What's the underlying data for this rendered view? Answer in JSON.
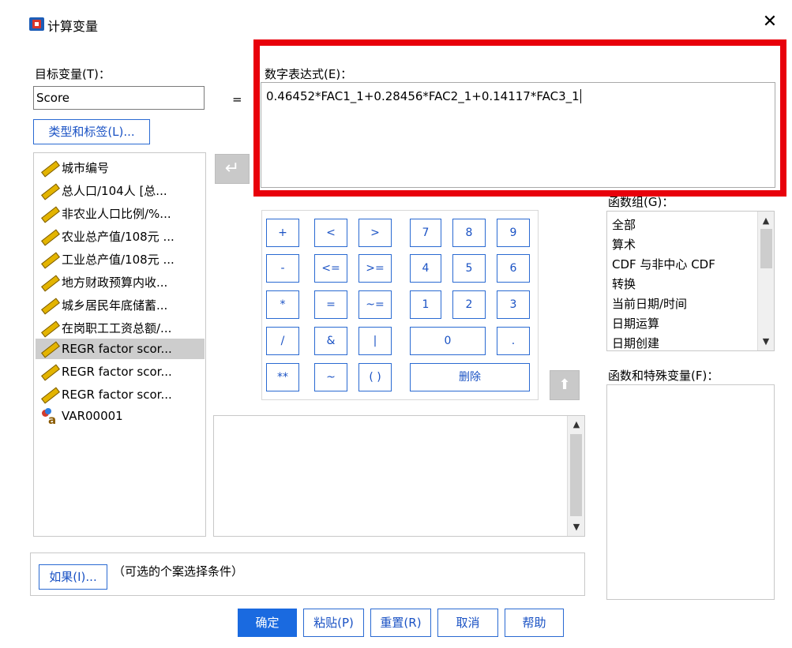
{
  "window": {
    "title": "计算变量",
    "close_glyph": "✕"
  },
  "target_variable": {
    "label": "目标变量(T)：",
    "value": "Score",
    "type_label_button": "类型和标签(L)..."
  },
  "equals_sign": "=",
  "numeric_expression": {
    "label": "数字表达式(E)：",
    "value": "0.46452*FAC1_1+0.28456*FAC2_1+0.14117*FAC3_1"
  },
  "variables": [
    {
      "label": "城市编号",
      "icon": "scale-ruler-icon",
      "selected": false
    },
    {
      "label": "总人口/104人 [总...",
      "icon": "scale-ruler-icon",
      "selected": false
    },
    {
      "label": "非农业人口比例/%...",
      "icon": "scale-ruler-icon",
      "selected": false
    },
    {
      "label": "农业总产值/108元 ...",
      "icon": "scale-ruler-icon",
      "selected": false
    },
    {
      "label": "工业总产值/108元 ...",
      "icon": "scale-ruler-icon",
      "selected": false
    },
    {
      "label": "地方财政预算内收...",
      "icon": "scale-ruler-icon",
      "selected": false
    },
    {
      "label": "城乡居民年底储蓄...",
      "icon": "scale-ruler-icon",
      "selected": false
    },
    {
      "label": "在岗职工工资总额/...",
      "icon": "scale-ruler-icon",
      "selected": false
    },
    {
      "label": "REGR factor scor...",
      "icon": "scale-ruler-icon",
      "selected": true
    },
    {
      "label": "REGR factor scor...",
      "icon": "scale-ruler-icon",
      "selected": false
    },
    {
      "label": "REGR factor scor...",
      "icon": "scale-ruler-icon",
      "selected": false
    },
    {
      "label": "VAR00001",
      "icon": "nominal-string-icon",
      "selected": false
    }
  ],
  "keypad": {
    "plus": "+",
    "lt": "<",
    "gt": ">",
    "k7": "7",
    "k8": "8",
    "k9": "9",
    "minus": "-",
    "le": "<=",
    "ge": ">=",
    "k4": "4",
    "k5": "5",
    "k6": "6",
    "mult": "*",
    "eq": "=",
    "ne": "~=",
    "k1": "1",
    "k2": "2",
    "k3": "3",
    "div": "/",
    "and": "&",
    "or": "|",
    "k0": "0",
    "dot": ".",
    "pow": "**",
    "not": "~",
    "paren": "( )",
    "delete": "删除"
  },
  "function_group": {
    "label": "函数组(G)：",
    "items": [
      "全部",
      "算术",
      "CDF 与非中心 CDF",
      "转换",
      "当前日期/时间",
      "日期运算",
      "日期创建"
    ]
  },
  "functions_special": {
    "label": "函数和特殊变量(F)："
  },
  "if_condition": {
    "button": "如果(I)...",
    "hint": "（可选的个案选择条件）"
  },
  "footer": {
    "ok": "确定",
    "paste": "粘贴(P)",
    "reset": "重置(R)",
    "cancel": "取消",
    "help": "帮助"
  },
  "colors": {
    "accent": "#2a6ad2",
    "highlight": "#e8000b",
    "selection": "#cdcdcd",
    "ok_button": "#1a6ae0"
  }
}
